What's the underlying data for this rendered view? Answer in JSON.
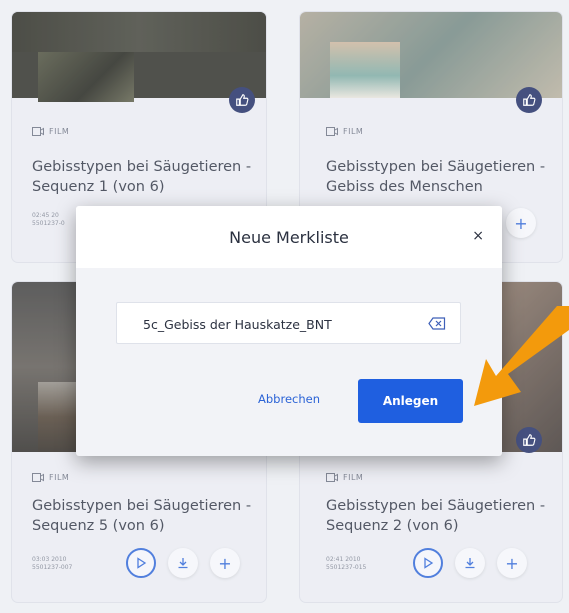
{
  "cards": [
    {
      "type_label": "FILM",
      "title_line1": "Gebisstypen bei Säugetieren -",
      "title_line2": "Sequenz 1 (von 6)",
      "duration_year": "02:45  20",
      "id": "5501237-0"
    },
    {
      "type_label": "FILM",
      "title_line1": "Gebisstypen bei Säugetieren -",
      "title_line2": "Gebiss des Menschen",
      "duration_year": "",
      "id": ""
    },
    {
      "type_label": "FILM",
      "title_line1": "Gebisstypen bei Säugetieren -",
      "title_line2": "Sequenz 5 (von 6)",
      "duration_year": "03:03  2010",
      "id": "5501237-007"
    },
    {
      "type_label": "FILM",
      "title_line1": "Gebisstypen bei Säugetieren -",
      "title_line2": "Sequenz 2 (von 6)",
      "duration_year": "02:41  2010",
      "id": "5501237-015"
    }
  ],
  "actions": {
    "add_symbol": "+"
  },
  "modal": {
    "title": "Neue Merkliste",
    "close_symbol": "×",
    "input_value": "5c_Gebiss der Hauskatze_BNT",
    "cancel_label": "Abbrechen",
    "create_label": "Anlegen"
  },
  "colors": {
    "accent_blue": "#1f5fe0",
    "like_badge": "#1d2a63",
    "arrow_orange": "#f39a0c"
  },
  "icons": [
    "thumbs-up-icon",
    "film-icon",
    "play-icon",
    "download-icon",
    "plus-icon",
    "close-icon",
    "backspace-icon",
    "arrow-annotation"
  ]
}
